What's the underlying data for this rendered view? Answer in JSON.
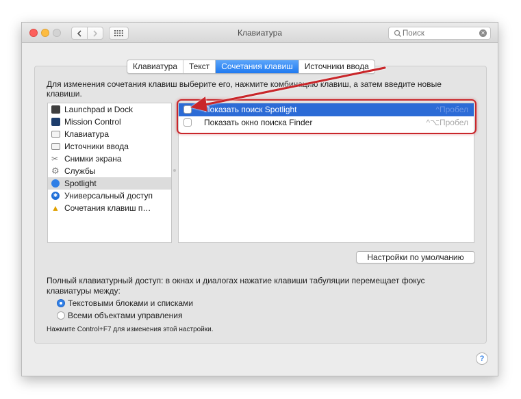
{
  "window": {
    "title": "Клавиатура",
    "search_placeholder": "Поиск"
  },
  "tabs": [
    {
      "label": "Клавиатура",
      "active": false
    },
    {
      "label": "Текст",
      "active": false
    },
    {
      "label": "Сочетания клавиш",
      "active": true
    },
    {
      "label": "Источники ввода",
      "active": false
    }
  ],
  "instruction": "Для изменения сочетания клавиш выберите его, нажмите комбинацию клавиш, а затем введите новые клавиши.",
  "categories": [
    {
      "label": "Launchpad и Dock",
      "icon": "launchpad-icon"
    },
    {
      "label": "Mission Control",
      "icon": "mission-control-icon"
    },
    {
      "label": "Клавиатура",
      "icon": "keyboard-icon"
    },
    {
      "label": "Источники ввода",
      "icon": "input-sources-icon"
    },
    {
      "label": "Снимки экрана",
      "icon": "screenshot-icon"
    },
    {
      "label": "Службы",
      "icon": "gear-icon"
    },
    {
      "label": "Spotlight",
      "icon": "spotlight-icon",
      "selected": true
    },
    {
      "label": "Универсальный доступ",
      "icon": "accessibility-icon"
    },
    {
      "label": "Сочетания клавиш п…",
      "icon": "app-shortcuts-icon"
    }
  ],
  "shortcuts": [
    {
      "label": "Показать поиск Spotlight",
      "keys": "^Пробел",
      "checked": false,
      "selected": true
    },
    {
      "label": "Показать окно поиска Finder",
      "keys": "^⌥Пробел",
      "checked": false,
      "selected": false
    }
  ],
  "defaults_button": "Настройки по умолчанию",
  "access": {
    "description": "Полный клавиатурный доступ: в окнах и диалогах нажатие клавиши табуляции перемещает фокус клавиатуры между:",
    "options": [
      {
        "label": "Текстовыми блоками и списками",
        "selected": true
      },
      {
        "label": "Всеми объектами управления",
        "selected": false
      }
    ],
    "hint": "Нажмите Control+F7 для изменения этой настройки."
  },
  "help_label": "?",
  "colors": {
    "accent": "#2c6bd6",
    "annotation": "#c9262b"
  }
}
